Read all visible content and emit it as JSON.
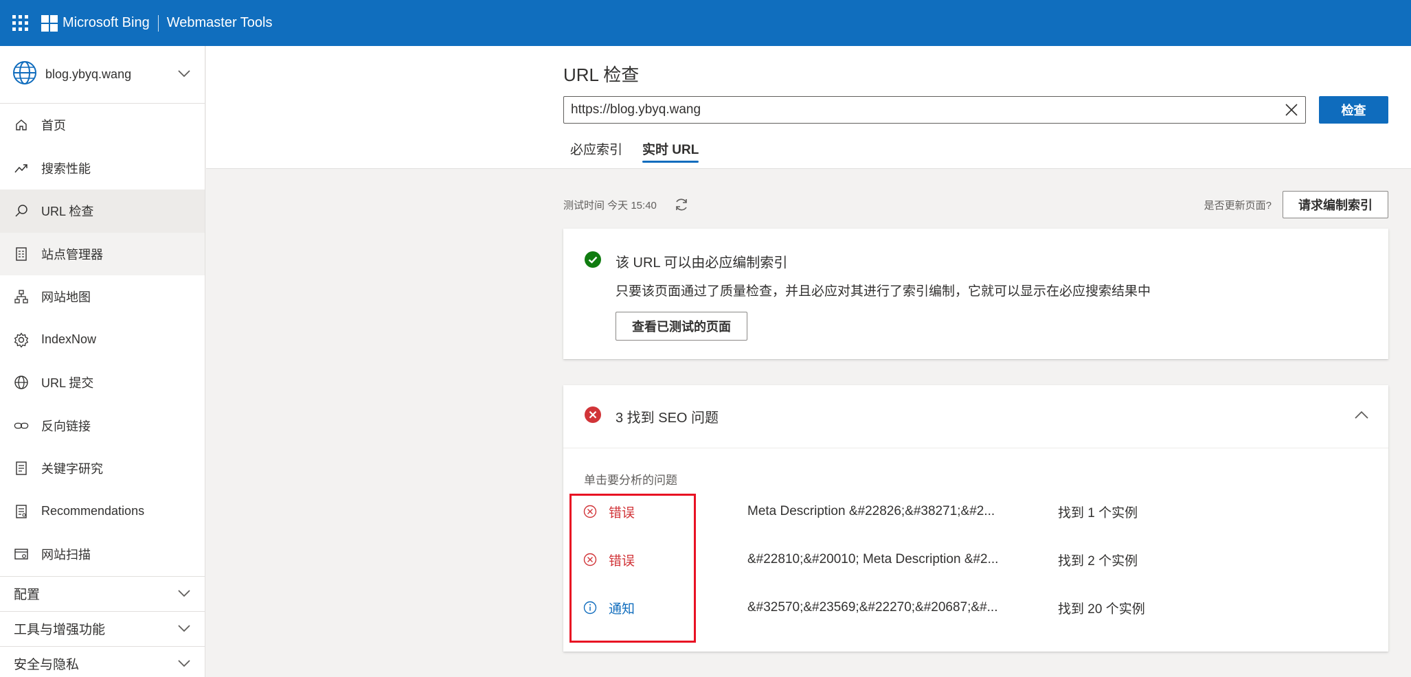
{
  "topbar": {
    "brand": "Microsoft Bing",
    "product": "Webmaster Tools"
  },
  "sidebar": {
    "site": "blog.ybyq.wang",
    "items": [
      {
        "label": "首页",
        "icon": "home-icon"
      },
      {
        "label": "搜索性能",
        "icon": "trend-icon"
      },
      {
        "label": "URL 检查",
        "icon": "search-icon"
      },
      {
        "label": "站点管理器",
        "icon": "document-icon"
      },
      {
        "label": "网站地图",
        "icon": "sitemap-icon"
      },
      {
        "label": "IndexNow",
        "icon": "gear-icon"
      },
      {
        "label": "URL 提交",
        "icon": "globe-icon"
      },
      {
        "label": "反向链接",
        "icon": "link-icon"
      },
      {
        "label": "关键字研究",
        "icon": "document-icon"
      },
      {
        "label": "Recommendations",
        "icon": "document-icon"
      },
      {
        "label": "网站扫描",
        "icon": "scan-icon"
      }
    ],
    "groups": [
      {
        "label": "配置"
      },
      {
        "label": "工具与增强功能"
      },
      {
        "label": "安全与隐私"
      }
    ]
  },
  "header": {
    "title": "URL 检查",
    "url_value": "https://blog.ybyq.wang",
    "inspect_button": "检查",
    "tabs": [
      {
        "label": "必应索引"
      },
      {
        "label": "实时 URL"
      }
    ]
  },
  "test": {
    "time_label": "测试时间 今天 15:40",
    "update_question": "是否更新页面?",
    "request_button": "请求编制索引"
  },
  "status_card": {
    "title": "该 URL 可以由必应编制索引",
    "description": "只要该页面通过了质量检查，并且必应对其进行了索引编制，它就可以显示在必应搜索结果中",
    "view_button": "查看已测试的页面"
  },
  "seo_card": {
    "title": "3 找到 SEO 问题",
    "hint": "单击要分析的问题",
    "issues": [
      {
        "severity": "错误",
        "description": "Meta Description &#22826;&#38271;&#2...",
        "count": "找到 1 个实例"
      },
      {
        "severity": "错误",
        "description": "&#22810;&#20010; Meta Description &#2...",
        "count": "找到 2 个实例"
      },
      {
        "severity": "通知",
        "description": "&#32570;&#23569;&#22270;&#20687;&#...",
        "count": "找到 20 个实例"
      }
    ]
  },
  "colors": {
    "brand": "#106ebe",
    "primary": "#0f6cbd",
    "error": "#d13438",
    "success": "#107c10",
    "highlight": "#e81123"
  }
}
